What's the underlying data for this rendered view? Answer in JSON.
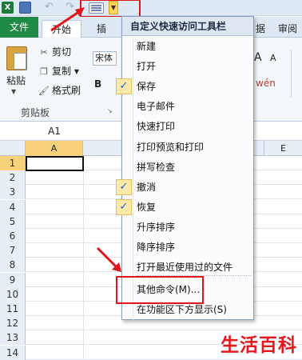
{
  "title_bar": {
    "excel_icon": "X",
    "undo_icon": "undo-icon",
    "redo_icon": "redo-icon",
    "form_icon": "form-icon",
    "dropdown_glyph": "▼"
  },
  "tabs": {
    "file": "文件",
    "home": "开始",
    "insert": "插",
    "data": "据",
    "review": "审阅"
  },
  "clipboard": {
    "paste": "粘贴",
    "cut": "剪切",
    "copy": "复制",
    "copy_arrow": "▾",
    "format_painter": "格式刷",
    "group_label": "剪贴板"
  },
  "font": {
    "name_box": "宋体",
    "bold": "B",
    "grow": "A",
    "shrink": "A",
    "wen": "wén"
  },
  "formula_bar": {
    "name_box": "A1"
  },
  "grid": {
    "columns": [
      "A",
      "E"
    ],
    "rows": [
      "1",
      "2",
      "3",
      "4",
      "5",
      "6",
      "7",
      "8",
      "9",
      "10",
      "11",
      "12",
      "13",
      "14"
    ],
    "selected_cell": "A1"
  },
  "menu": {
    "title": "自定义快速访问工具栏",
    "items": [
      {
        "label": "新建",
        "checked": false
      },
      {
        "label": "打开",
        "checked": false
      },
      {
        "label": "保存",
        "checked": true
      },
      {
        "label": "电子邮件",
        "checked": false
      },
      {
        "label": "快速打印",
        "checked": false
      },
      {
        "label": "打印预览和打印",
        "checked": false
      },
      {
        "label": "拼写检查",
        "checked": false
      },
      {
        "label": "撤消",
        "checked": true
      },
      {
        "label": "恢复",
        "checked": true
      },
      {
        "label": "升序排序",
        "checked": false
      },
      {
        "label": "降序排序",
        "checked": false
      },
      {
        "label": "打开最近使用过的文件",
        "checked": false
      },
      {
        "label": "其他命令(M)...",
        "checked": false
      },
      {
        "label": "在功能区下方显示(S)",
        "checked": false
      }
    ],
    "check_glyph": "✓"
  },
  "accent": {
    "excel_green": "#1f8a43",
    "highlight_red": "#e0161b",
    "selection_gold": "#f8d27a"
  },
  "watermark": "生活百科"
}
